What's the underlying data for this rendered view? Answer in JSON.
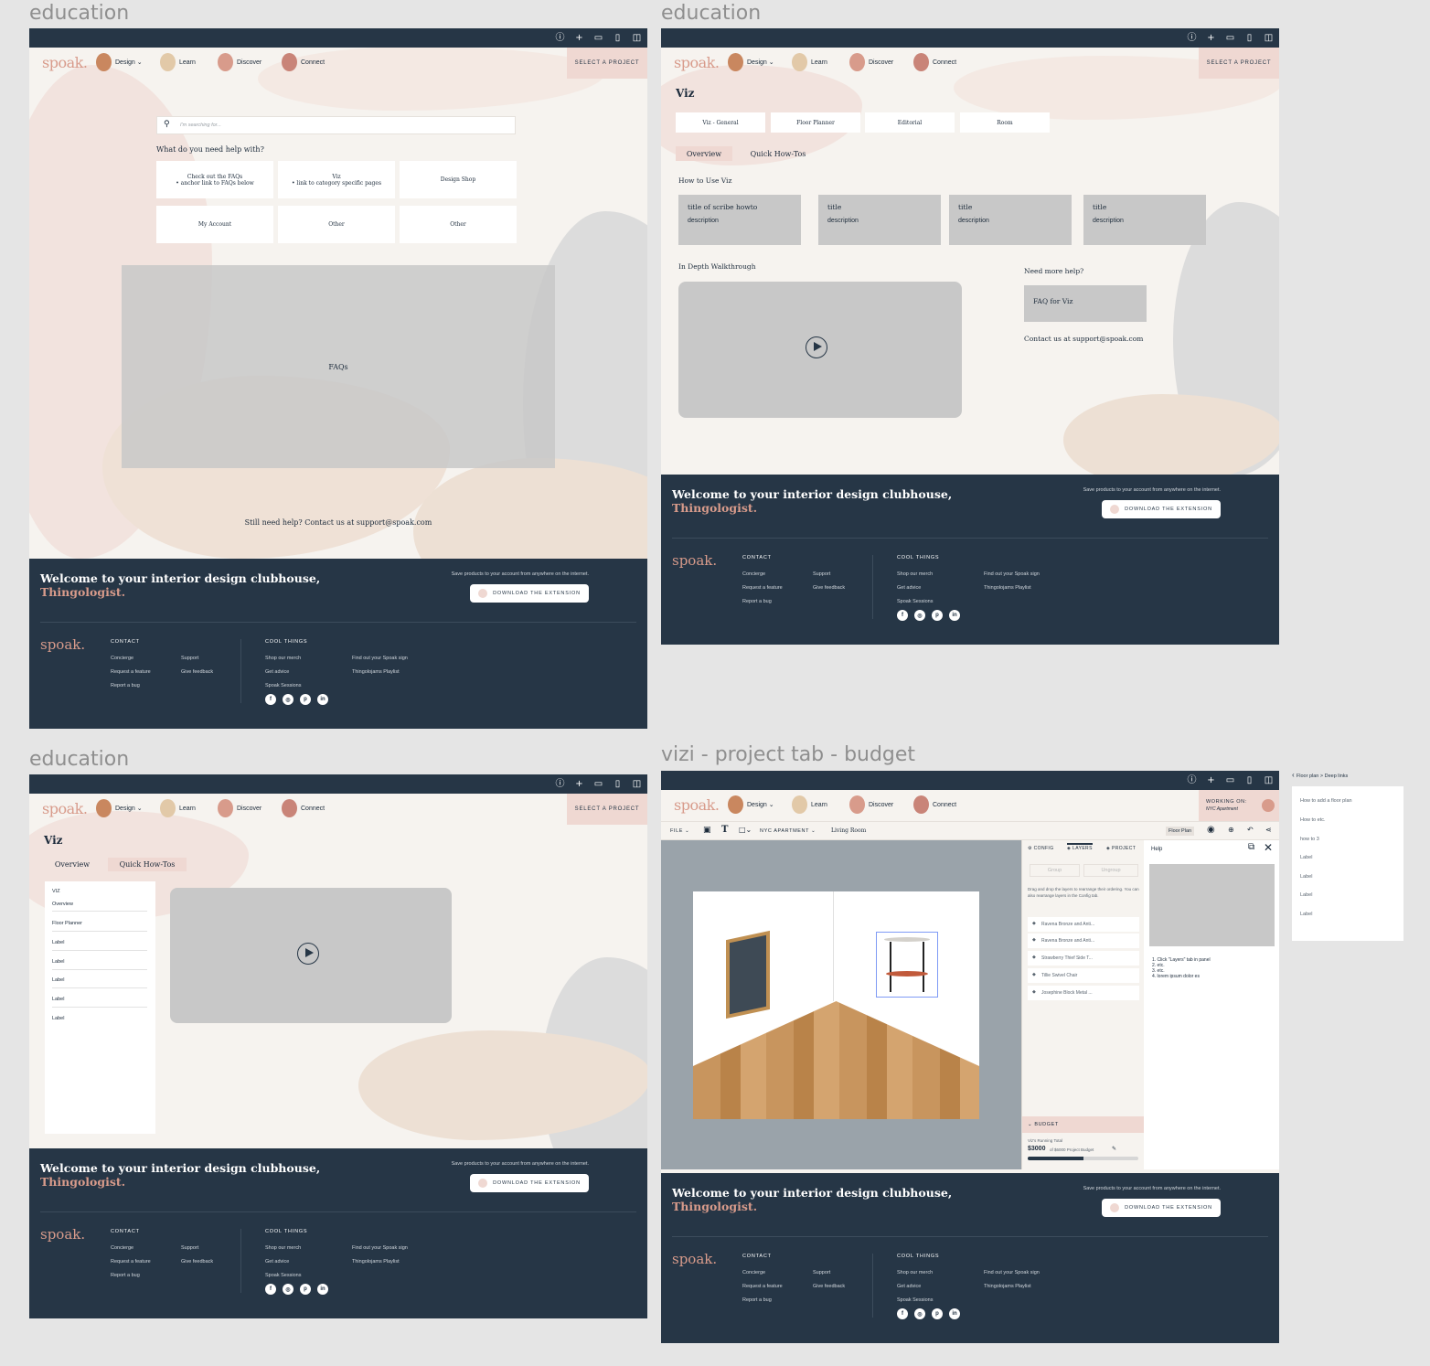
{
  "frames": {
    "f1": {
      "title": "education"
    },
    "f2": {
      "title": "education"
    },
    "f3": {
      "title": "education"
    },
    "f4": {
      "title": "vizi - project tab - budget"
    }
  },
  "nav": {
    "logo": "spoak.",
    "design": "Design ⌄",
    "learn": "Learn",
    "discover": "Discover",
    "connect": "Connect",
    "select_project": "SELECT A PROJECT"
  },
  "ext_icons": [
    "info-icon",
    "plus-icon",
    "card-icon",
    "bookmark-icon",
    "bag-icon"
  ],
  "footer": {
    "welcome": "Welcome to your interior design clubhouse,",
    "thingologist": "Thingologist.",
    "save_text": "Save products to your account from anywhere on the internet.",
    "download": "DOWNLOAD THE EXTENSION",
    "logo": "spoak.",
    "contact": "CONTACT",
    "concierge": "Concierge",
    "request": "Request a feature",
    "report": "Report a bug",
    "support": "Support",
    "feedback": "Give feedback",
    "cool": "COOL THINGS",
    "merch": "Shop our merch",
    "advice": "Get advice",
    "sessions": "Spoak Sessions",
    "sign": "Find out your Spoak sign",
    "playlist": "Thingolojams Playlist"
  },
  "help": {
    "search_placeholder": "I'm searching for...",
    "question": "What do you need help with?",
    "cards": [
      {
        "title": "Check out the FAQs",
        "sub": "• anchor link to FAQs below"
      },
      {
        "title": "Viz",
        "sub": "• link to category specific pages"
      },
      {
        "title": "Design Shop",
        "sub": ""
      },
      {
        "title": "My Account",
        "sub": ""
      },
      {
        "title": "Other",
        "sub": ""
      },
      {
        "title": "Other",
        "sub": ""
      }
    ],
    "faqs": "FAQs",
    "still_need": "Still need help? Contact us at support@spoak.com"
  },
  "viz": {
    "title": "Viz",
    "categories": [
      "Viz - General",
      "Floor Planner",
      "Editorial",
      "Room"
    ],
    "tab_overview": "Overview",
    "tab_howtos": "Quick How-Tos",
    "how_to_use": "How to Use Viz",
    "howtos": [
      {
        "title": "title of scribe howto",
        "desc": "description"
      },
      {
        "title": "title",
        "desc": "description"
      },
      {
        "title": "title",
        "desc": "description"
      },
      {
        "title": "title",
        "desc": "description"
      }
    ],
    "walkthrough": "In Depth Walkthrough",
    "need_more": "Need more help?",
    "faq_viz": "FAQ for Viz",
    "contact_us": "Contact us at support@spoak.com"
  },
  "howtos_page": {
    "title": "Viz",
    "tab_overview": "Overview",
    "tab_howtos": "Quick How-Tos",
    "list": [
      "VIZ",
      "Overview",
      "Floor Planner",
      "Label",
      "Label",
      "Label",
      "Label",
      "Label"
    ]
  },
  "editor": {
    "working_on": "WORKING ON:",
    "project_name": "NYC Apartment",
    "file": "FILE ⌄",
    "project_menu": "NYC APARTMENT ⌄",
    "room": "Living Room",
    "floor_plan": "Floor Plan",
    "tabs": [
      "CONFIG",
      "LAYERS",
      "PROJECT"
    ],
    "group": "Group",
    "ungroup": "Ungroup",
    "hint": "Drag and drop the layers to rearrange their ordering. You can also rearrange layers in the Config tab.",
    "layers": [
      "Ravena Bronze and Anti...",
      "Ravena Bronze and Anti...",
      "Strawberry Thief Side T...",
      "Tillie Swivel Chair",
      "Josephine Block Metal ..."
    ],
    "budget": "BUDGET",
    "running_total": "Viz's Running Total",
    "amount": "$3000",
    "of_budget": "of $6000 Project Budget",
    "budget_fraction": 0.5,
    "help_title": "Help",
    "steps": [
      "1. Click \"Layers\" tab in panel",
      "2. etc.",
      "3. etc.",
      "4. lorem ipsum dolor es"
    ]
  },
  "deep_links": {
    "crumb": "Floor plan > Deep links",
    "links": [
      "How to add a floor plan",
      "How to etc.",
      "how to 3",
      "Label",
      "Label",
      "Label",
      "Label"
    ]
  },
  "colors": {
    "navy": "#263646",
    "pink": "#d89b8b",
    "cream": "#f6f3ef",
    "blush": "#efd8d2"
  }
}
